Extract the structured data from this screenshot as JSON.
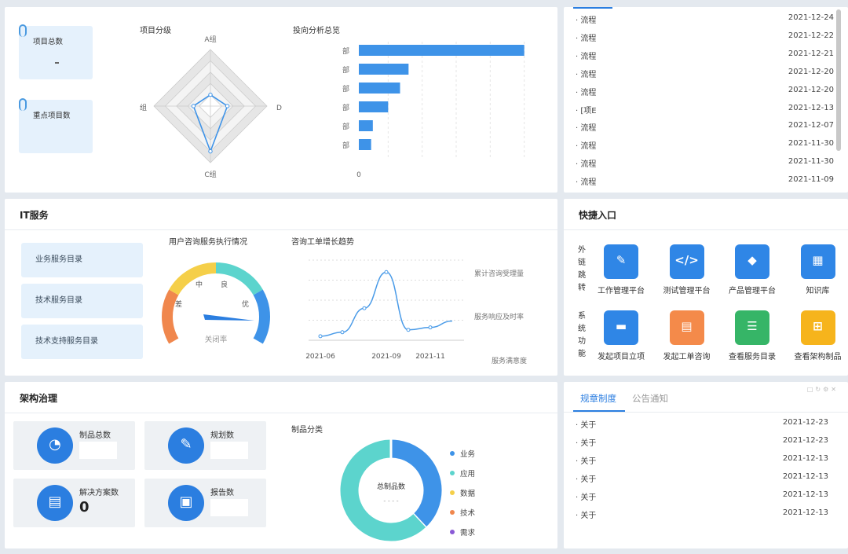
{
  "top_left": {
    "card1_label": "项目总数",
    "card2_label": "重点项目数",
    "radar_title": "项目分级",
    "radar_labels": [
      "A组",
      "D",
      "C组",
      "组"
    ],
    "bar_title": "投向分析总览",
    "bar_categories": [
      "部",
      "部",
      "部",
      "部",
      "部",
      "部"
    ],
    "bar_values": [
      100,
      32,
      27,
      20,
      11,
      10
    ],
    "bar_axis_zero": "0"
  },
  "flow_list": [
    {
      "title": "流程",
      "date": "2021-12-24"
    },
    {
      "title": "流程",
      "date": "2021-12-22"
    },
    {
      "title": "流程",
      "date": "2021-12-21"
    },
    {
      "title": "流程",
      "date": "2021-12-20"
    },
    {
      "title": "流程",
      "date": "2021-12-20"
    },
    {
      "title": "[项E",
      "date": "2021-12-13"
    },
    {
      "title": "流程",
      "date": "2021-12-07"
    },
    {
      "title": "流程",
      "date": "2021-11-30"
    },
    {
      "title": "流程",
      "date": "2021-11-30"
    },
    {
      "title": "流程",
      "date": "2021-11-09"
    }
  ],
  "it_service": {
    "title": "IT服务",
    "buttons": [
      "业务服务目录",
      "技术服务目录",
      "技术支持服务目录"
    ],
    "gauge_title": "用户咨询服务执行情况",
    "gauge_labels": {
      "poor": "差",
      "mid": "中",
      "good": "良",
      "excellent": "优",
      "center": "关闭率"
    },
    "gauge_colors": [
      "#f0874d",
      "#f5cf49",
      "#5cd4cd",
      "#3e93e8"
    ],
    "trend_title": "咨询工单增长趋势",
    "trend_x_labels": [
      "2021-06",
      "2021-09",
      "2021-11"
    ],
    "trend_legend": [
      "累计咨询受理量",
      "服务响应及时率",
      "服务满意度"
    ]
  },
  "quick_entry": {
    "title": "快捷入口",
    "group1_label": [
      "外",
      "链",
      "跳",
      "转"
    ],
    "group2_label": [
      "系",
      "统",
      "功",
      "能"
    ],
    "row1": [
      {
        "label": "工作管理平台",
        "color": "#2f86e6",
        "icon": "edit-icon"
      },
      {
        "label": "测试管理平台",
        "color": "#2f86e6",
        "icon": "code-icon"
      },
      {
        "label": "产品管理平台",
        "color": "#2f86e6",
        "icon": "diamond-icon"
      },
      {
        "label": "知识库",
        "color": "#2f86e6",
        "icon": "grid-icon"
      }
    ],
    "row2": [
      {
        "label": "发起项目立项",
        "color": "#2f86e6",
        "icon": "folder-icon"
      },
      {
        "label": "发起工单咨询",
        "color": "#f48a4a",
        "icon": "ticket-icon"
      },
      {
        "label": "查看服务目录",
        "color": "#36b567",
        "icon": "list-icon"
      },
      {
        "label": "查看架构制品",
        "color": "#f6b41c",
        "icon": "hierarchy-icon"
      }
    ]
  },
  "arch": {
    "title": "架构治理",
    "stats": [
      {
        "label": "制品总数",
        "value": "",
        "icon": "pie-icon"
      },
      {
        "label": "规划数",
        "value": "",
        "icon": "pen-icon"
      },
      {
        "label": "解决方案数",
        "value": "0",
        "icon": "clipboard-icon"
      },
      {
        "label": "报告数",
        "value": "",
        "icon": "report-icon"
      }
    ],
    "donut_title": "制品分类",
    "donut_center": "总制品数",
    "donut_center_value": "- - - -",
    "legend": [
      {
        "name": "业务",
        "color": "#3e93e8"
      },
      {
        "name": "应用",
        "color": "#5cd4cd"
      },
      {
        "name": "数据",
        "color": "#f5cf49"
      },
      {
        "name": "技术",
        "color": "#f0874d"
      },
      {
        "name": "需求",
        "color": "#8a5ad6"
      }
    ]
  },
  "notice": {
    "tabs": [
      "规章制度",
      "公告通知"
    ],
    "items": [
      {
        "title": "关于",
        "date": "2021-12-23"
      },
      {
        "title": "关于",
        "date": "2021-12-23"
      },
      {
        "title": "关于",
        "date": "2021-12-13"
      },
      {
        "title": "关于",
        "date": "2021-12-13"
      },
      {
        "title": "关于",
        "date": "2021-12-13"
      },
      {
        "title": "关于",
        "date": "2021-12-13"
      }
    ]
  },
  "chart_data": [
    {
      "type": "bar",
      "title": "投向分析总览",
      "categories": [
        "部",
        "部",
        "部",
        "部",
        "部",
        "部"
      ],
      "values": [
        100,
        32,
        27,
        20,
        11,
        10
      ],
      "xlim": [
        0,
        120
      ]
    },
    {
      "type": "radar",
      "title": "项目分级",
      "categories": [
        "A组",
        "D",
        "C组",
        "组"
      ],
      "values": [
        2.0,
        3.0,
        8.0,
        3.0
      ],
      "rlim": [
        0,
        10
      ]
    },
    {
      "type": "line",
      "title": "咨询工单增长趋势",
      "x": [
        "2021-06",
        "2021-07",
        "2021-08",
        "2021-09",
        "2021-10",
        "2021-11",
        "2021-12"
      ],
      "values": [
        0.5,
        1.0,
        4.0,
        8.5,
        1.3,
        1.6,
        2.4
      ],
      "ylim": [
        0,
        10
      ]
    },
    {
      "type": "pie",
      "title": "制品分类",
      "categories": [
        "业务",
        "应用",
        "数据",
        "技术",
        "需求"
      ],
      "values": [
        38,
        62,
        0,
        0,
        0
      ]
    }
  ]
}
